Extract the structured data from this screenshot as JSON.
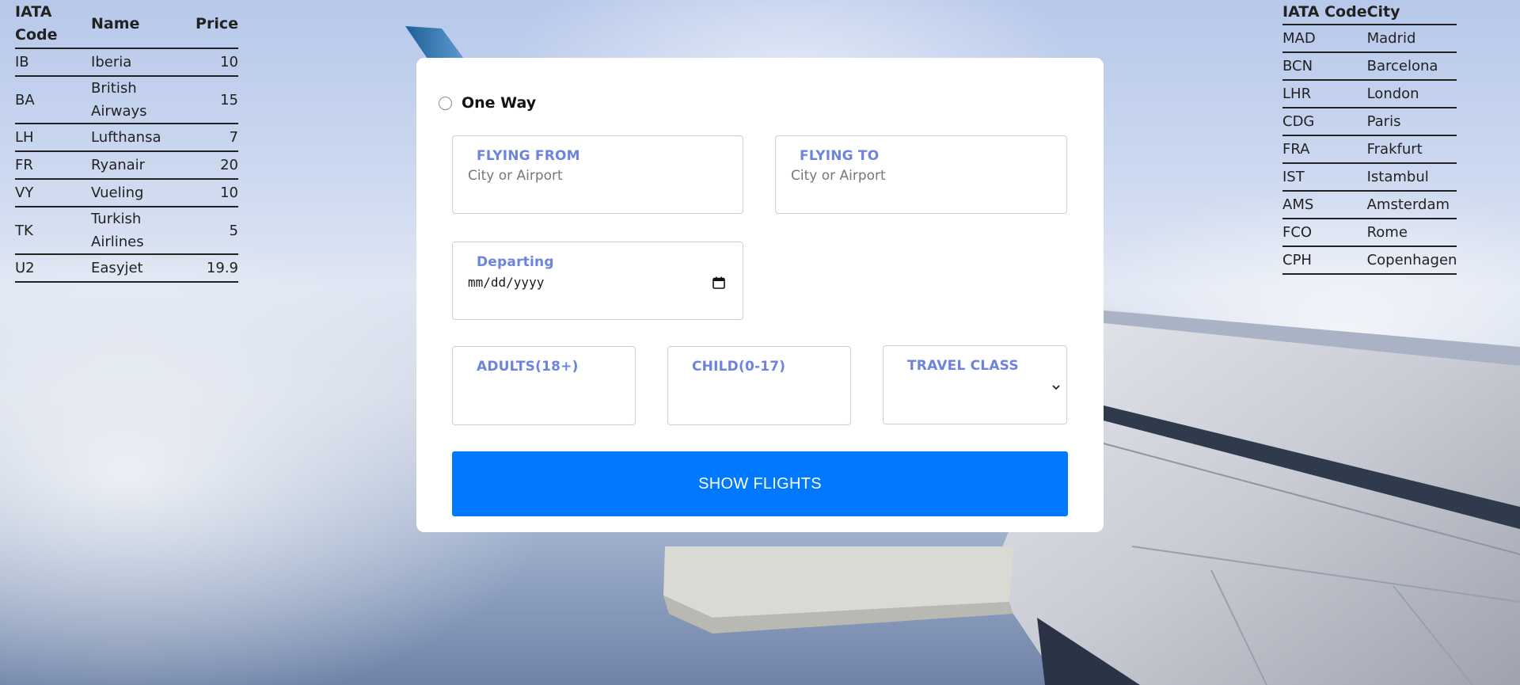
{
  "airlines_table": {
    "headers": [
      "IATA Code",
      "Name",
      "Price"
    ],
    "rows": [
      {
        "code": "IB",
        "name": "Iberia",
        "price": "10"
      },
      {
        "code": "BA",
        "name": "British Airways",
        "price": "15"
      },
      {
        "code": "LH",
        "name": "Lufthansa",
        "price": "7"
      },
      {
        "code": "FR",
        "name": "Ryanair",
        "price": "20"
      },
      {
        "code": "VY",
        "name": "Vueling",
        "price": "10"
      },
      {
        "code": "TK",
        "name": "Turkish Airlines",
        "price": "5"
      },
      {
        "code": "U2",
        "name": "Easyjet",
        "price": "19.9"
      }
    ]
  },
  "cities_table": {
    "headers": [
      "IATA Code",
      "City"
    ],
    "rows": [
      {
        "code": "MAD",
        "city": "Madrid"
      },
      {
        "code": "BCN",
        "city": "Barcelona"
      },
      {
        "code": "LHR",
        "city": "London"
      },
      {
        "code": "CDG",
        "city": "Paris"
      },
      {
        "code": "FRA",
        "city": "Frakfurt"
      },
      {
        "code": "IST",
        "city": "Istambul"
      },
      {
        "code": "AMS",
        "city": "Amsterdam"
      },
      {
        "code": "FCO",
        "city": "Rome"
      },
      {
        "code": "CPH",
        "city": "Copenhagen"
      }
    ]
  },
  "form": {
    "trip_type_label": "One Way",
    "flying_from": {
      "label": "FLYING FROM",
      "placeholder": "City or Airport",
      "value": ""
    },
    "flying_to": {
      "label": "FLYING TO",
      "placeholder": "City or Airport",
      "value": ""
    },
    "departing": {
      "label": "Departing",
      "value": "mm/dd/yyyy"
    },
    "adults": {
      "label": "ADULTS(18+)",
      "value": ""
    },
    "child": {
      "label": "CHILD(0-17)",
      "value": ""
    },
    "travel_class": {
      "label": "TRAVEL CLASS",
      "value": ""
    },
    "submit_label": "SHOW FLIGHTS"
  },
  "colors": {
    "accent": "#0179fe",
    "field_label": "#6d83de"
  },
  "icons": {
    "departing": "calendar-icon",
    "travel_class": "chevron-down-icon"
  }
}
